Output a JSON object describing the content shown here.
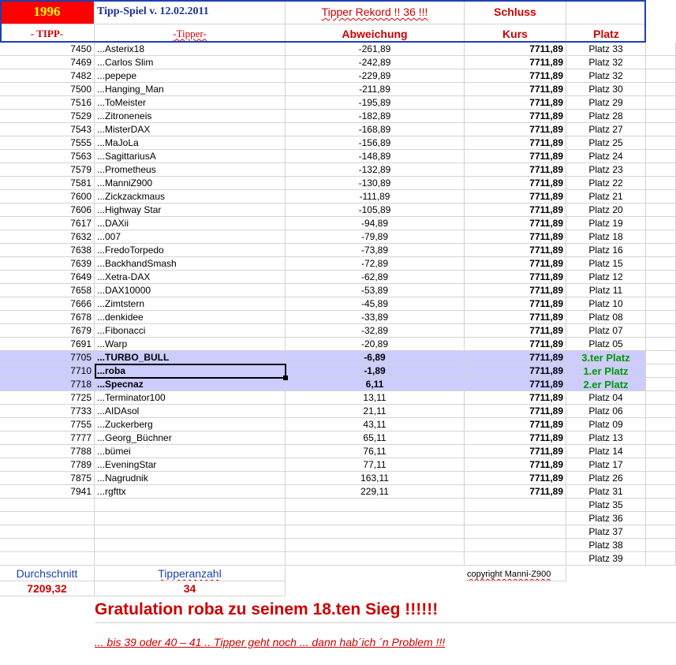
{
  "header": {
    "year": "1996",
    "game_title": "Tipp-Spiel v. 12.02.2011",
    "record_label": "Tipper Rekord !!  36  !!!",
    "schluss_label": "Schluss",
    "col_tipp": "- TIPP-",
    "col_tipper": "-Tipper-",
    "col_abweichung": "Abweichung",
    "col_kurs": "Kurs",
    "col_platz": "Platz"
  },
  "rows": [
    {
      "tipp": "7450",
      "tipper": "...Asterix18",
      "abw": "-261,89",
      "kurs": "7711,89",
      "platz": "Platz 33"
    },
    {
      "tipp": "7469",
      "tipper": "...Carlos Slim",
      "abw": "-242,89",
      "kurs": "7711,89",
      "platz": "Platz 32"
    },
    {
      "tipp": "7482",
      "tipper": "...pepepe",
      "abw": "-229,89",
      "kurs": "7711,89",
      "platz": "Platz 32"
    },
    {
      "tipp": "7500",
      "tipper": "...Hanging_Man",
      "abw": "-211,89",
      "kurs": "7711,89",
      "platz": "Platz 30"
    },
    {
      "tipp": "7516",
      "tipper": "...ToMeister",
      "abw": "-195,89",
      "kurs": "7711,89",
      "platz": "Platz 29"
    },
    {
      "tipp": "7529",
      "tipper": "...Zitroneneis",
      "abw": "-182,89",
      "kurs": "7711,89",
      "platz": "Platz 28"
    },
    {
      "tipp": "7543",
      "tipper": "...MisterDAX",
      "abw": "-168,89",
      "kurs": "7711,89",
      "platz": "Platz 27"
    },
    {
      "tipp": "7555",
      "tipper": "...MaJoLa",
      "abw": "-156,89",
      "kurs": "7711,89",
      "platz": "Platz 25"
    },
    {
      "tipp": "7563",
      "tipper": "...SagittariusA",
      "abw": "-148,89",
      "kurs": "7711,89",
      "platz": "Platz 24"
    },
    {
      "tipp": "7579",
      "tipper": "...Prometheus",
      "abw": "-132,89",
      "kurs": "7711,89",
      "platz": "Platz 23"
    },
    {
      "tipp": "7581",
      "tipper": "...ManniZ900",
      "abw": "-130,89",
      "kurs": "7711,89",
      "platz": "Platz 22"
    },
    {
      "tipp": "7600",
      "tipper": "...Zickzackmaus",
      "abw": "-111,89",
      "kurs": "7711,89",
      "platz": "Platz 21"
    },
    {
      "tipp": "7606",
      "tipper": "...Highway Star",
      "abw": "-105,89",
      "kurs": "7711,89",
      "platz": "Platz 20"
    },
    {
      "tipp": "7617",
      "tipper": "...DAXii",
      "abw": "-94,89",
      "kurs": "7711,89",
      "platz": "Platz 19"
    },
    {
      "tipp": "7632",
      "tipper": "...007",
      "abw": "-79,89",
      "kurs": "7711,89",
      "platz": "Platz 18"
    },
    {
      "tipp": "7638",
      "tipper": "...FredoTorpedo",
      "abw": "-73,89",
      "kurs": "7711,89",
      "platz": "Platz 16"
    },
    {
      "tipp": "7639",
      "tipper": "...BackhandSmash",
      "abw": "-72,89",
      "kurs": "7711,89",
      "platz": "Platz 15"
    },
    {
      "tipp": "7649",
      "tipper": "...Xetra-DAX",
      "abw": "-62,89",
      "kurs": "7711,89",
      "platz": "Platz 12"
    },
    {
      "tipp": "7658",
      "tipper": "...DAX10000",
      "abw": "-53,89",
      "kurs": "7711,89",
      "platz": "Platz 11"
    },
    {
      "tipp": "7666",
      "tipper": "...Zimtstern",
      "abw": "-45,89",
      "kurs": "7711,89",
      "platz": "Platz 10"
    },
    {
      "tipp": "7678",
      "tipper": "...denkidee",
      "abw": "-33,89",
      "kurs": "7711,89",
      "platz": "Platz 08"
    },
    {
      "tipp": "7679",
      "tipper": "...Fibonacci",
      "abw": "-32,89",
      "kurs": "7711,89",
      "platz": "Platz 07"
    },
    {
      "tipp": "7691",
      "tipper": "...Warp",
      "abw": "-20,89",
      "kurs": "7711,89",
      "platz": "Platz 05"
    },
    {
      "tipp": "7705",
      "tipper": "...TURBO_BULL",
      "abw": "-6,89",
      "kurs": "7711,89",
      "platz": "3.ter Platz",
      "highlight": true
    },
    {
      "tipp": "7710",
      "tipper": "...roba",
      "abw": "-1,89",
      "kurs": "7711,89",
      "platz": "1.er Platz",
      "highlight": true
    },
    {
      "tipp": "7718",
      "tipper": "...Specnaz",
      "abw": "6,11",
      "kurs": "7711,89",
      "platz": "2.er Platz",
      "highlight": true
    },
    {
      "tipp": "7725",
      "tipper": "...Terminator100",
      "abw": "13,11",
      "kurs": "7711,89",
      "platz": "Platz 04"
    },
    {
      "tipp": "7733",
      "tipper": "...AIDAsol",
      "abw": "21,11",
      "kurs": "7711,89",
      "platz": "Platz 06"
    },
    {
      "tipp": "7755",
      "tipper": "...Zuckerberg",
      "abw": "43,11",
      "kurs": "7711,89",
      "platz": "Platz 09"
    },
    {
      "tipp": "7777",
      "tipper": "...Georg_Büchner",
      "abw": "65,11",
      "kurs": "7711,89",
      "platz": "Platz 13"
    },
    {
      "tipp": "7788",
      "tipper": "...bümei",
      "abw": "76,11",
      "kurs": "7711,89",
      "platz": "Platz 14"
    },
    {
      "tipp": "7789",
      "tipper": "...EveningStar",
      "abw": "77,11",
      "kurs": "7711,89",
      "platz": "Platz 17"
    },
    {
      "tipp": "7875",
      "tipper": "...Nagrudnik",
      "abw": "163,11",
      "kurs": "7711,89",
      "platz": "Platz 26"
    },
    {
      "tipp": "7941",
      "tipper": "...rgfttx",
      "abw": "229,11",
      "kurs": "7711,89",
      "platz": "Platz 31"
    },
    {
      "tipp": "",
      "tipper": "",
      "abw": "",
      "kurs": "",
      "platz": "Platz 35"
    },
    {
      "tipp": "",
      "tipper": "",
      "abw": "",
      "kurs": "",
      "platz": "Platz 36"
    },
    {
      "tipp": "",
      "tipper": "",
      "abw": "",
      "kurs": "",
      "platz": "Platz 37"
    },
    {
      "tipp": "",
      "tipper": "",
      "abw": "",
      "kurs": "",
      "platz": "Platz 38"
    },
    {
      "tipp": "",
      "tipper": "",
      "abw": "",
      "kurs": "",
      "platz": "Platz 39"
    }
  ],
  "footer": {
    "avg_label": "Durchschnitt",
    "avg_value": "7209,32",
    "count_label": "Tipperanzahl",
    "count_value": "34",
    "copyright": "copyright Manni-Z900",
    "congrats": "Gratulation roba  zu seinem 18.ten Sieg !!!!!!",
    "note": "... bis 39 oder 40 – 41 .. Tipper geht noch ... dann hab´ich ´n Problem !!!"
  },
  "colors": {
    "header_border": "#1f3fb3",
    "year_bg": "#ff0000",
    "year_text": "#ffff00",
    "title_blue": "#1f2f9f",
    "red": "#cc0000",
    "highlight_bg": "#ccccff",
    "winner_green": "#009900"
  }
}
